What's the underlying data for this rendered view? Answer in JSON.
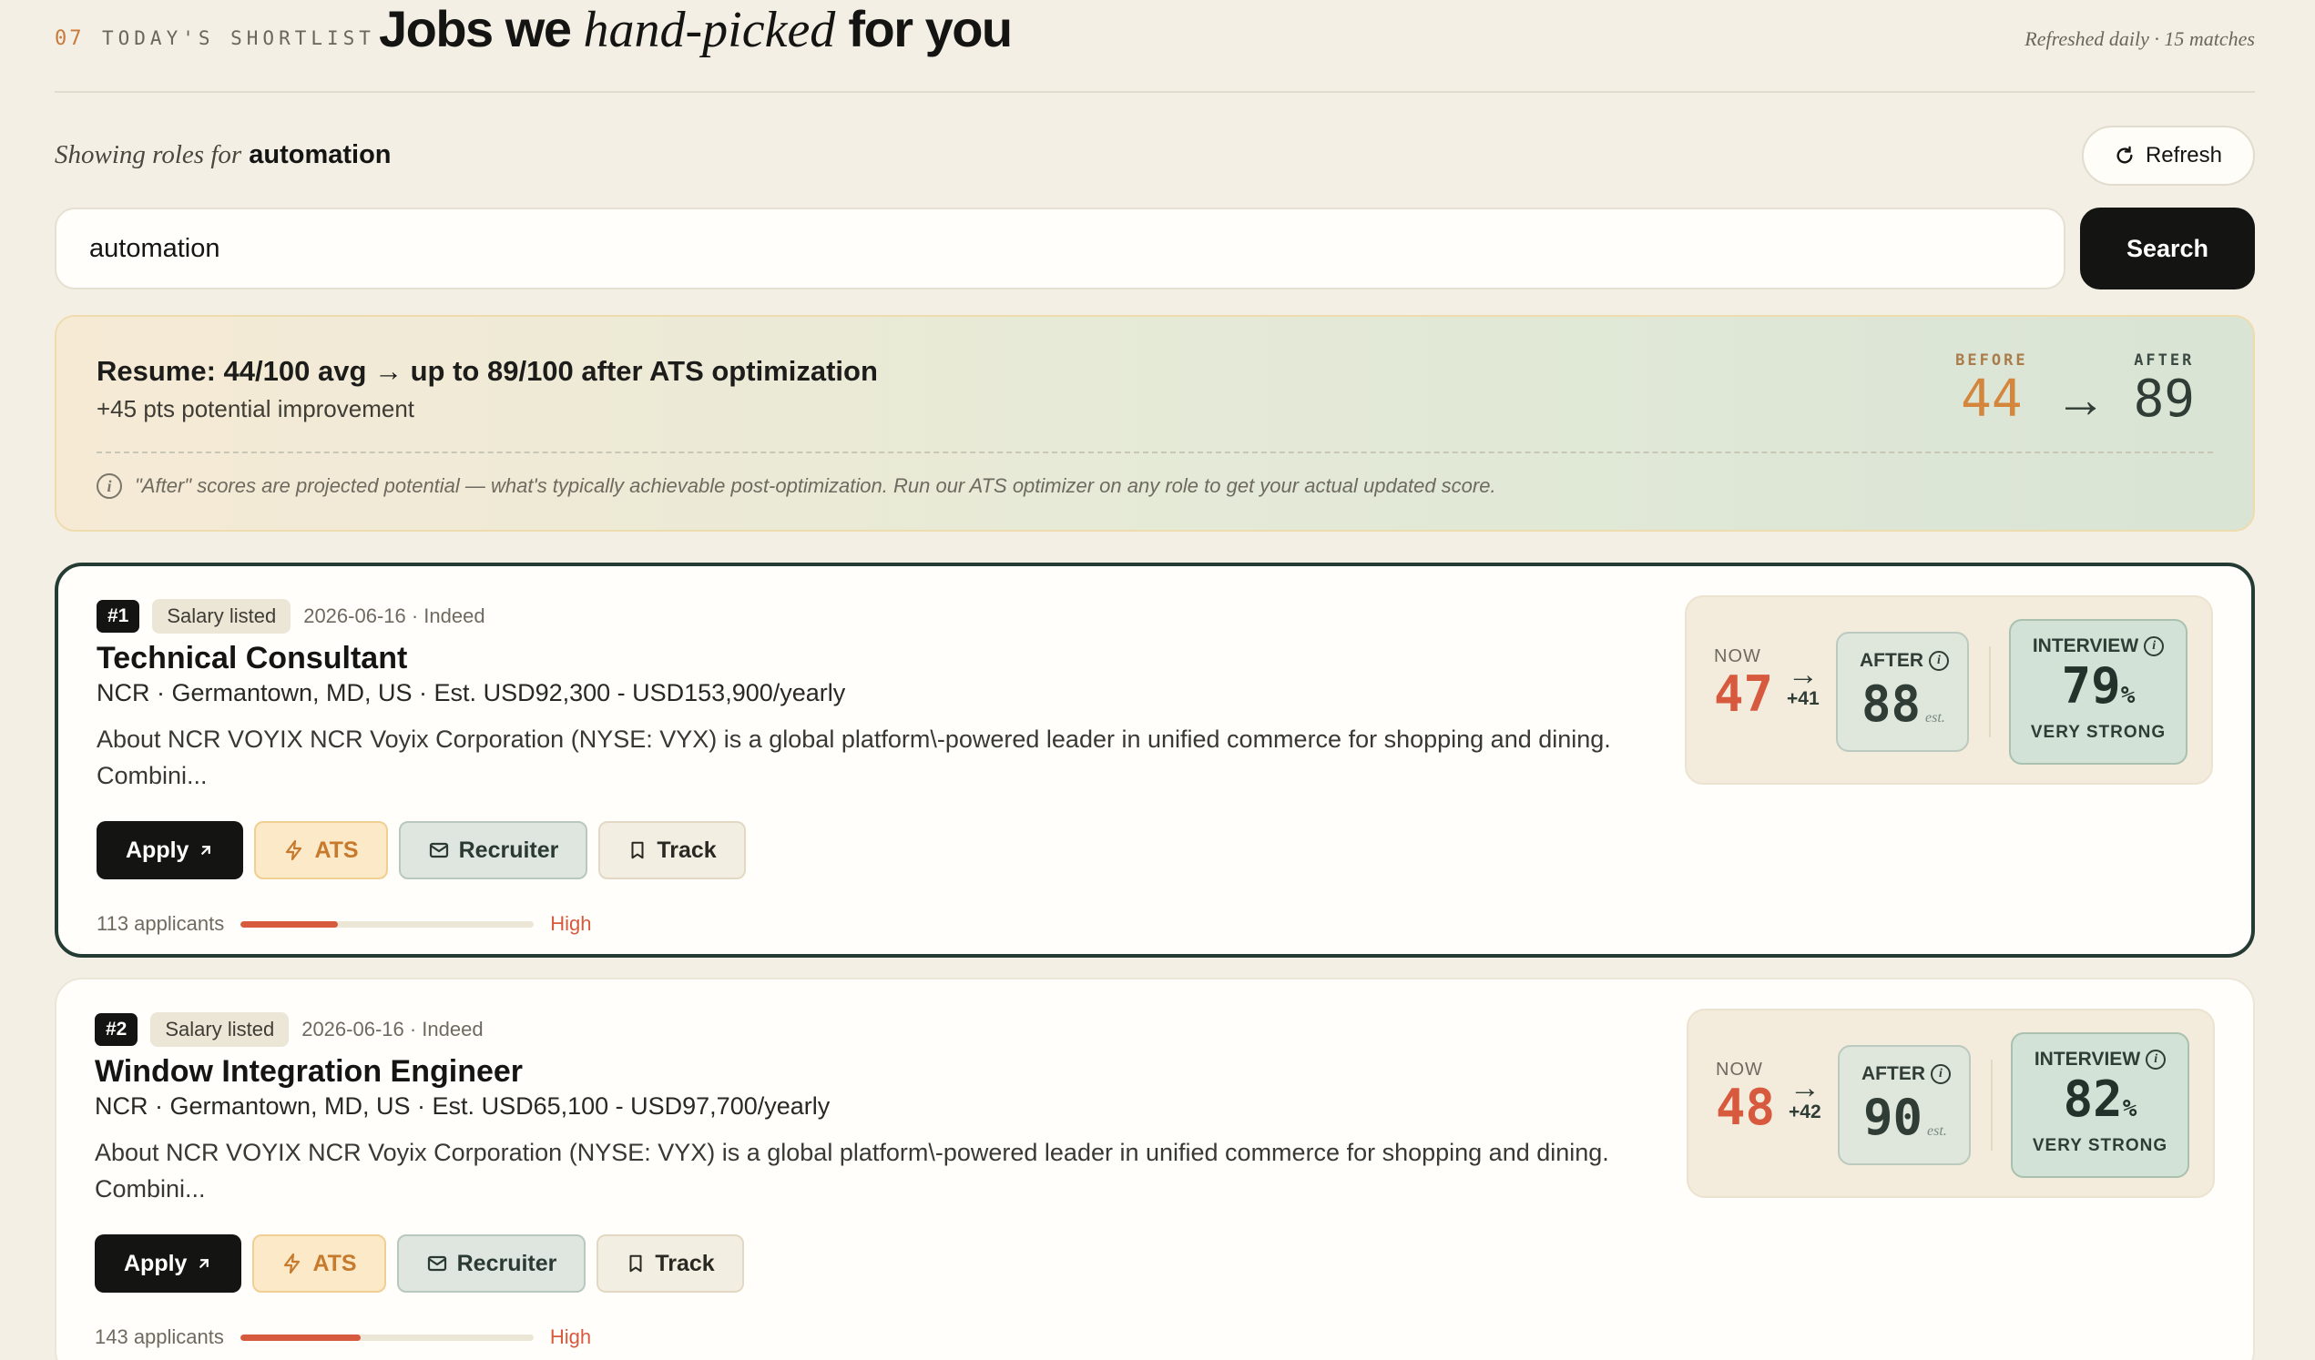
{
  "header": {
    "section_num": "07",
    "section_tag": "TODAY'S SHORTLIST",
    "title_pre": "Jobs we",
    "title_accent": "hand-picked",
    "title_post": "for you",
    "refreshed": "Refreshed daily · 15 matches"
  },
  "query": {
    "lead": "Showing roles for",
    "term": "automation",
    "refresh_label": "Refresh",
    "search_value": "automation",
    "search_label": "Search"
  },
  "resume": {
    "title": "Resume: 44/100 avg → up to 89/100 after ATS optimization",
    "sub": "+45 pts potential improvement",
    "note": "\"After\" scores are projected potential — what's typically achievable post-optimization. Run our ATS optimizer on any role to get your actual updated score.",
    "before_label": "BEFORE",
    "before": "44",
    "after_label": "AFTER",
    "after": "89"
  },
  "colors": {
    "accent_orange": "#d4863c",
    "red": "#d85a3e",
    "dark_green": "#243b33"
  },
  "jobs": [
    {
      "rank": "#1",
      "tag": "Salary listed",
      "meta": "2026-06-16 · Indeed",
      "title": "Technical Consultant",
      "sub": "NCR · Germantown, MD, US · Est. USD92,300 - USD153,900/yearly",
      "desc": "About NCR VOYIX NCR Voyix Corporation (NYSE: VYX) is a global platform\\-powered leader in unified commerce for shopping and dining. Combini...",
      "apply": "Apply",
      "ats": "ATS",
      "recruiter": "Recruiter",
      "track": "Track",
      "applicants": "113 applicants",
      "competition_level": 0.33,
      "level": "High",
      "now_label": "NOW",
      "now": "47",
      "delta": "+41",
      "after_label": "AFTER",
      "after": "88",
      "est": "est.",
      "interview_label": "INTERVIEW",
      "interview": "79",
      "pct": "%",
      "interview_tag": "VERY STRONG"
    },
    {
      "rank": "#2",
      "tag": "Salary listed",
      "meta": "2026-06-16 · Indeed",
      "title": "Window Integration Engineer",
      "sub": "NCR · Germantown, MD, US · Est. USD65,100 - USD97,700/yearly",
      "desc": "About NCR VOYIX NCR Voyix Corporation (NYSE: VYX) is a global platform\\-powered leader in unified commerce for shopping and dining. Combini...",
      "apply": "Apply",
      "ats": "ATS",
      "recruiter": "Recruiter",
      "track": "Track",
      "applicants": "143 applicants",
      "competition_level": 0.41,
      "level": "High",
      "now_label": "NOW",
      "now": "48",
      "delta": "+42",
      "after_label": "AFTER",
      "after": "90",
      "est": "est.",
      "interview_label": "INTERVIEW",
      "interview": "82",
      "pct": "%",
      "interview_tag": "VERY STRONG"
    }
  ]
}
